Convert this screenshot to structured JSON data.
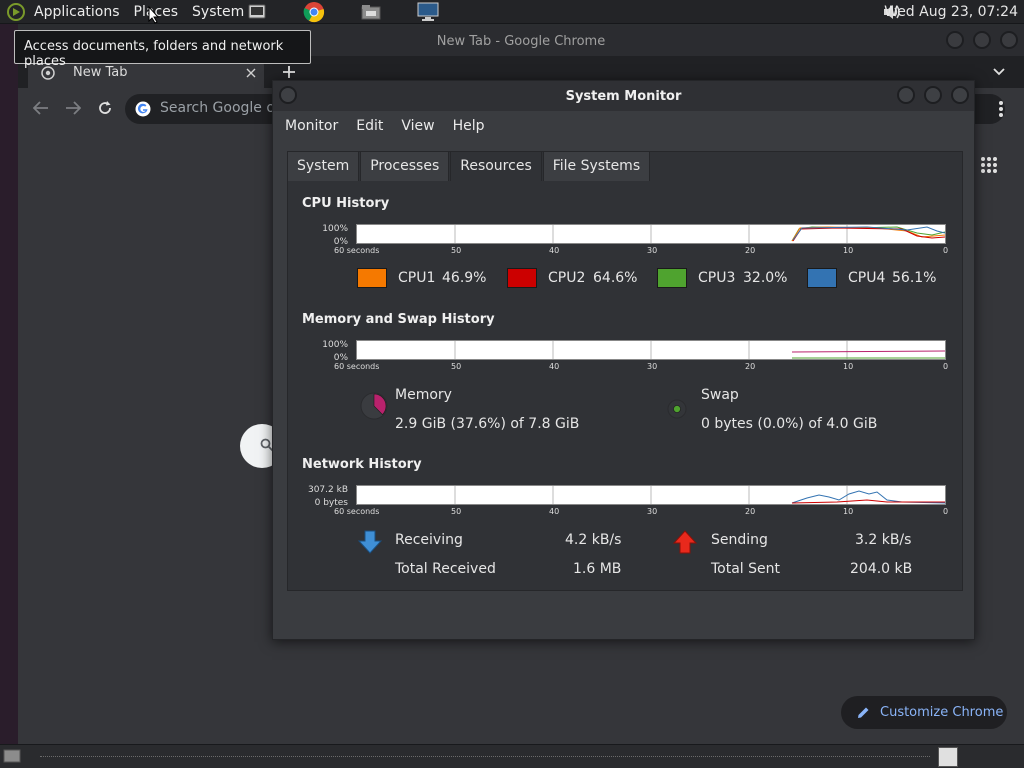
{
  "top_panel": {
    "menu": [
      "Applications",
      "Places",
      "System"
    ],
    "clock": "Wed Aug 23, 07:24",
    "icons": [
      "system-logo-icon",
      "terminal-icon",
      "chrome-icon",
      "file-manager-icon",
      "monitor-icon",
      "volume-icon"
    ]
  },
  "tooltip": "Access documents, folders and network places",
  "chrome": {
    "window_title": "New Tab - Google Chrome",
    "tab_title": "New Tab",
    "omnibox_placeholder": "Search Google or t",
    "customize_label": "Customize Chrome"
  },
  "sysmon": {
    "title": "System Monitor",
    "menu": [
      "Monitor",
      "Edit",
      "View",
      "Help"
    ],
    "tabs": [
      "System",
      "Processes",
      "Resources",
      "File Systems"
    ],
    "active_tab": "Resources",
    "cpu": {
      "title": "CPU History",
      "y_top": "100%",
      "y_bottom": "0%",
      "x_labels": [
        "60 seconds",
        "50",
        "40",
        "30",
        "20",
        "10",
        "0"
      ],
      "items": [
        {
          "name": "CPU1",
          "value": "46.9%",
          "color": "#f57900"
        },
        {
          "name": "CPU2",
          "value": "64.6%",
          "color": "#cc0000"
        },
        {
          "name": "CPU3",
          "value": "32.0%",
          "color": "#4fa32f"
        },
        {
          "name": "CPU4",
          "value": "56.1%",
          "color": "#3373b2"
        }
      ]
    },
    "memory": {
      "title": "Memory and Swap History",
      "y_top": "100%",
      "y_bottom": "0%",
      "x_labels": [
        "60 seconds",
        "50",
        "40",
        "30",
        "20",
        "10",
        "0"
      ],
      "memory_label": "Memory",
      "memory_value": "2.9 GiB (37.6%) of 7.8 GiB",
      "memory_color": "#b8226c",
      "memory_fraction": 0.376,
      "swap_label": "Swap",
      "swap_value": "0 bytes (0.0%) of 4.0 GiB",
      "swap_color": "#4fa32f"
    },
    "network": {
      "title": "Network History",
      "y_top": "307.2 kB",
      "y_bottom": "0 bytes",
      "x_labels": [
        "60 seconds",
        "50",
        "40",
        "30",
        "20",
        "10",
        "0"
      ],
      "receiving_label": "Receiving",
      "receiving_value": "4.2 kB/s",
      "total_received_label": "Total Received",
      "total_received_value": "1.6 MB",
      "sending_label": "Sending",
      "sending_value": "3.2 kB/s",
      "total_sent_label": "Total Sent",
      "total_sent_value": "204.0 kB",
      "receiving_color": "#3373b2",
      "sending_color": "#cc0000"
    }
  }
}
